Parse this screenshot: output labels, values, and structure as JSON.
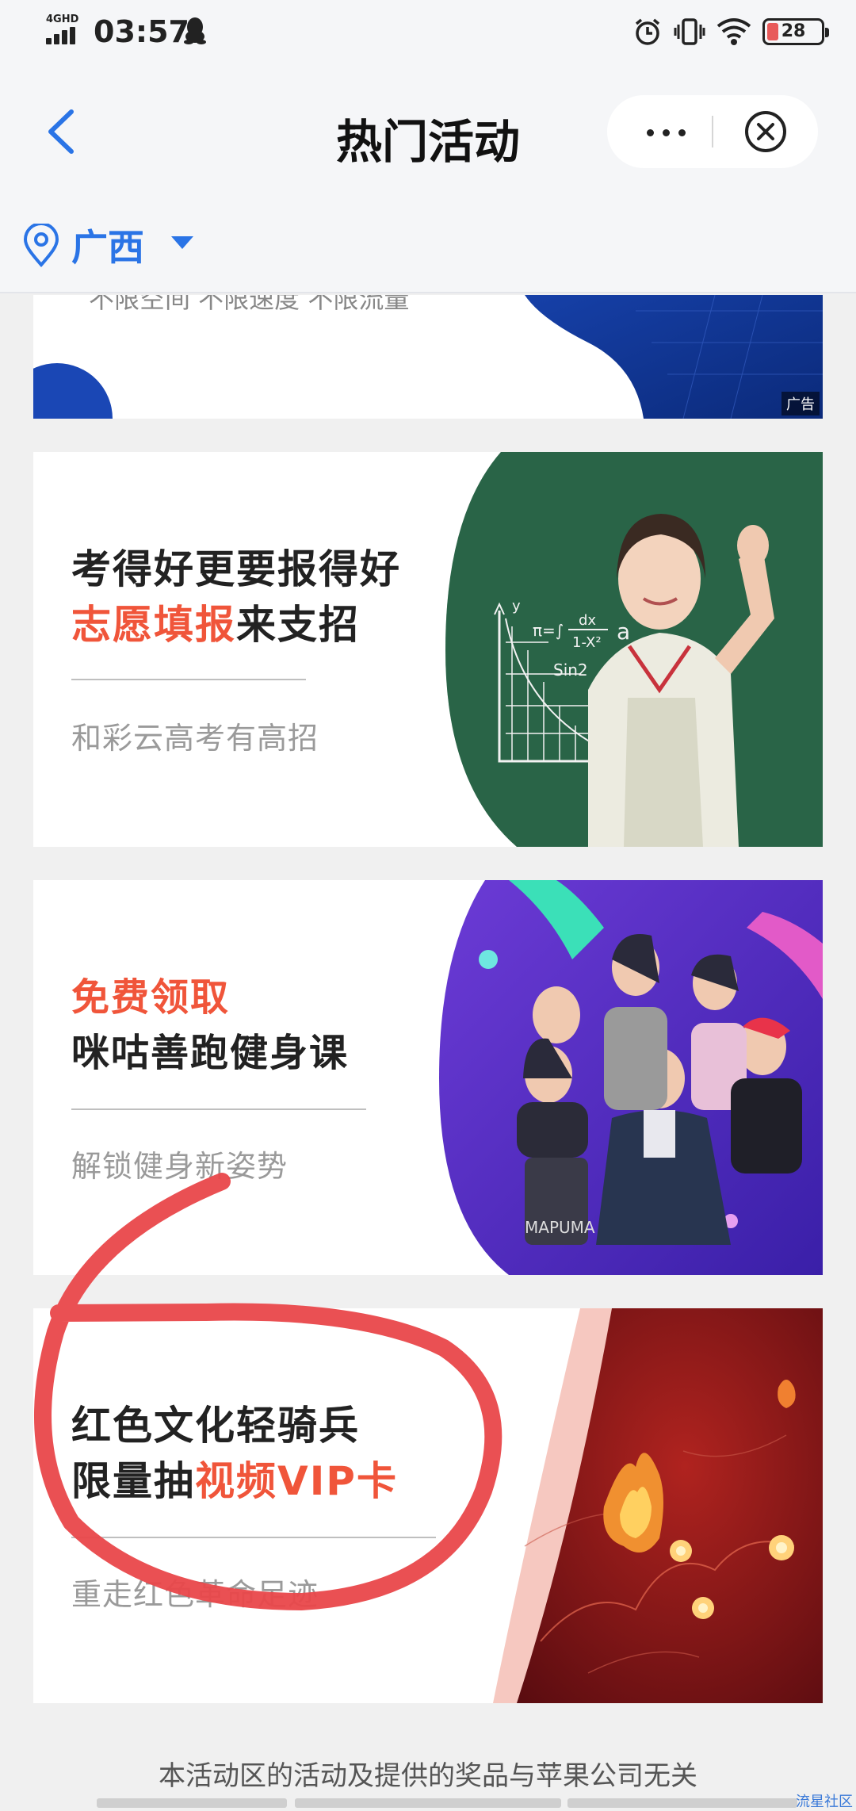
{
  "status_bar": {
    "network": "4GHD",
    "time": "03:57",
    "battery": "28",
    "battery_level_percent": 28
  },
  "nav": {
    "title": "热门活动"
  },
  "location": {
    "name": "广西"
  },
  "cards": [
    {
      "partial_text": "不限空间 不限速度 不限流量",
      "ad_label": "广告",
      "colors": {
        "accent": "#1a3ea8"
      }
    },
    {
      "line1": "考得好更要报得好",
      "line2_highlight": "志愿填报",
      "line2_rest": "来支招",
      "subtitle": "和彩云高考有高招",
      "board_text": {
        "sin": "Sin2",
        "pi": "π=∫",
        "dx": "dx",
        "frac": "1-X²",
        "a": "a",
        "y": "y"
      }
    },
    {
      "line1_highlight": "免费领取",
      "line2": "咪咕善跑健身课",
      "subtitle": "解锁健身新姿势",
      "shirt_text": "MAPUMA"
    },
    {
      "line1": "红色文化轻骑兵",
      "line2_plain": "限量抽",
      "line2_highlight": "视频VIP卡",
      "subtitle": "重走红色革命足迹"
    }
  ],
  "footer": {
    "note": "本活动区的活动及提供的奖品与苹果公司无关",
    "watermark": "流星社区"
  },
  "colors": {
    "accent": "#2a74e6",
    "highlight": "#f0553a",
    "annotation": "#e9474a"
  }
}
